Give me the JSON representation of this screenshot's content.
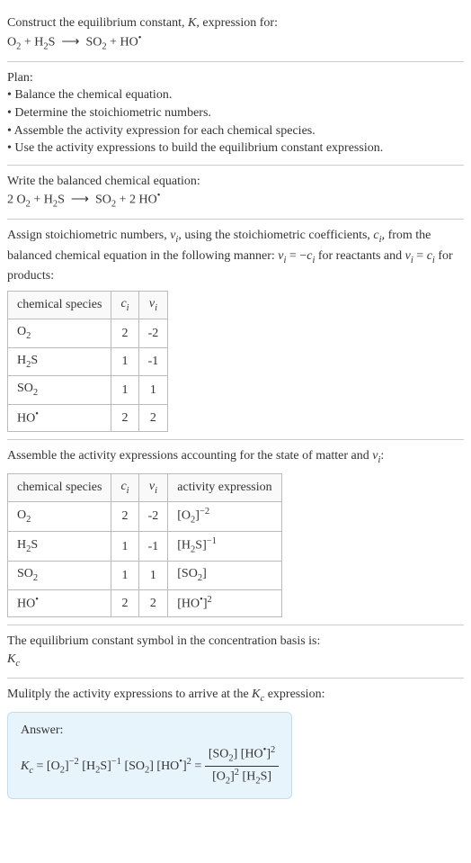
{
  "construct": {
    "heading": "Construct the equilibrium constant, K, expression for:",
    "equation": "O₂ + H₂S ⟶ SO₂ + HO•"
  },
  "plan": {
    "heading": "Plan:",
    "items": [
      "• Balance the chemical equation.",
      "• Determine the stoichiometric numbers.",
      "• Assemble the activity expression for each chemical species.",
      "• Use the activity expressions to build the equilibrium constant expression."
    ]
  },
  "balanced": {
    "heading": "Write the balanced chemical equation:",
    "equation": "2 O₂ + H₂S ⟶ SO₂ + 2 HO•"
  },
  "assign": {
    "heading_html": "Assign stoichiometric numbers, νᵢ, using the stoichiometric coefficients, cᵢ, from the balanced chemical equation in the following manner: νᵢ = −cᵢ for reactants and νᵢ = cᵢ for products:",
    "headers": [
      "chemical species",
      "cᵢ",
      "νᵢ"
    ],
    "rows": [
      {
        "species": "O₂",
        "c": "2",
        "v": "-2"
      },
      {
        "species": "H₂S",
        "c": "1",
        "v": "-1"
      },
      {
        "species": "SO₂",
        "c": "1",
        "v": "1"
      },
      {
        "species": "HO•",
        "c": "2",
        "v": "2"
      }
    ]
  },
  "activity": {
    "heading": "Assemble the activity expressions accounting for the state of matter and νᵢ:",
    "headers": [
      "chemical species",
      "cᵢ",
      "νᵢ",
      "activity expression"
    ],
    "rows": [
      {
        "species": "O₂",
        "c": "2",
        "v": "-2",
        "expr": "[O₂]⁻²"
      },
      {
        "species": "H₂S",
        "c": "1",
        "v": "-1",
        "expr": "[H₂S]⁻¹"
      },
      {
        "species": "SO₂",
        "c": "1",
        "v": "1",
        "expr": "[SO₂]"
      },
      {
        "species": "HO•",
        "c": "2",
        "v": "2",
        "expr": "[HO•]²"
      }
    ]
  },
  "symbol": {
    "heading": "The equilibrium constant symbol in the concentration basis is:",
    "symbol": "K𝚌"
  },
  "multiply": {
    "heading": "Mulitply the activity expressions to arrive at the K𝚌 expression:"
  },
  "answer": {
    "label": "Answer:",
    "lhs": "K𝚌 = [O₂]⁻² [H₂S]⁻¹ [SO₂] [HO•]² =",
    "num": "[SO₂] [HO•]²",
    "den": "[O₂]² [H₂S]"
  }
}
